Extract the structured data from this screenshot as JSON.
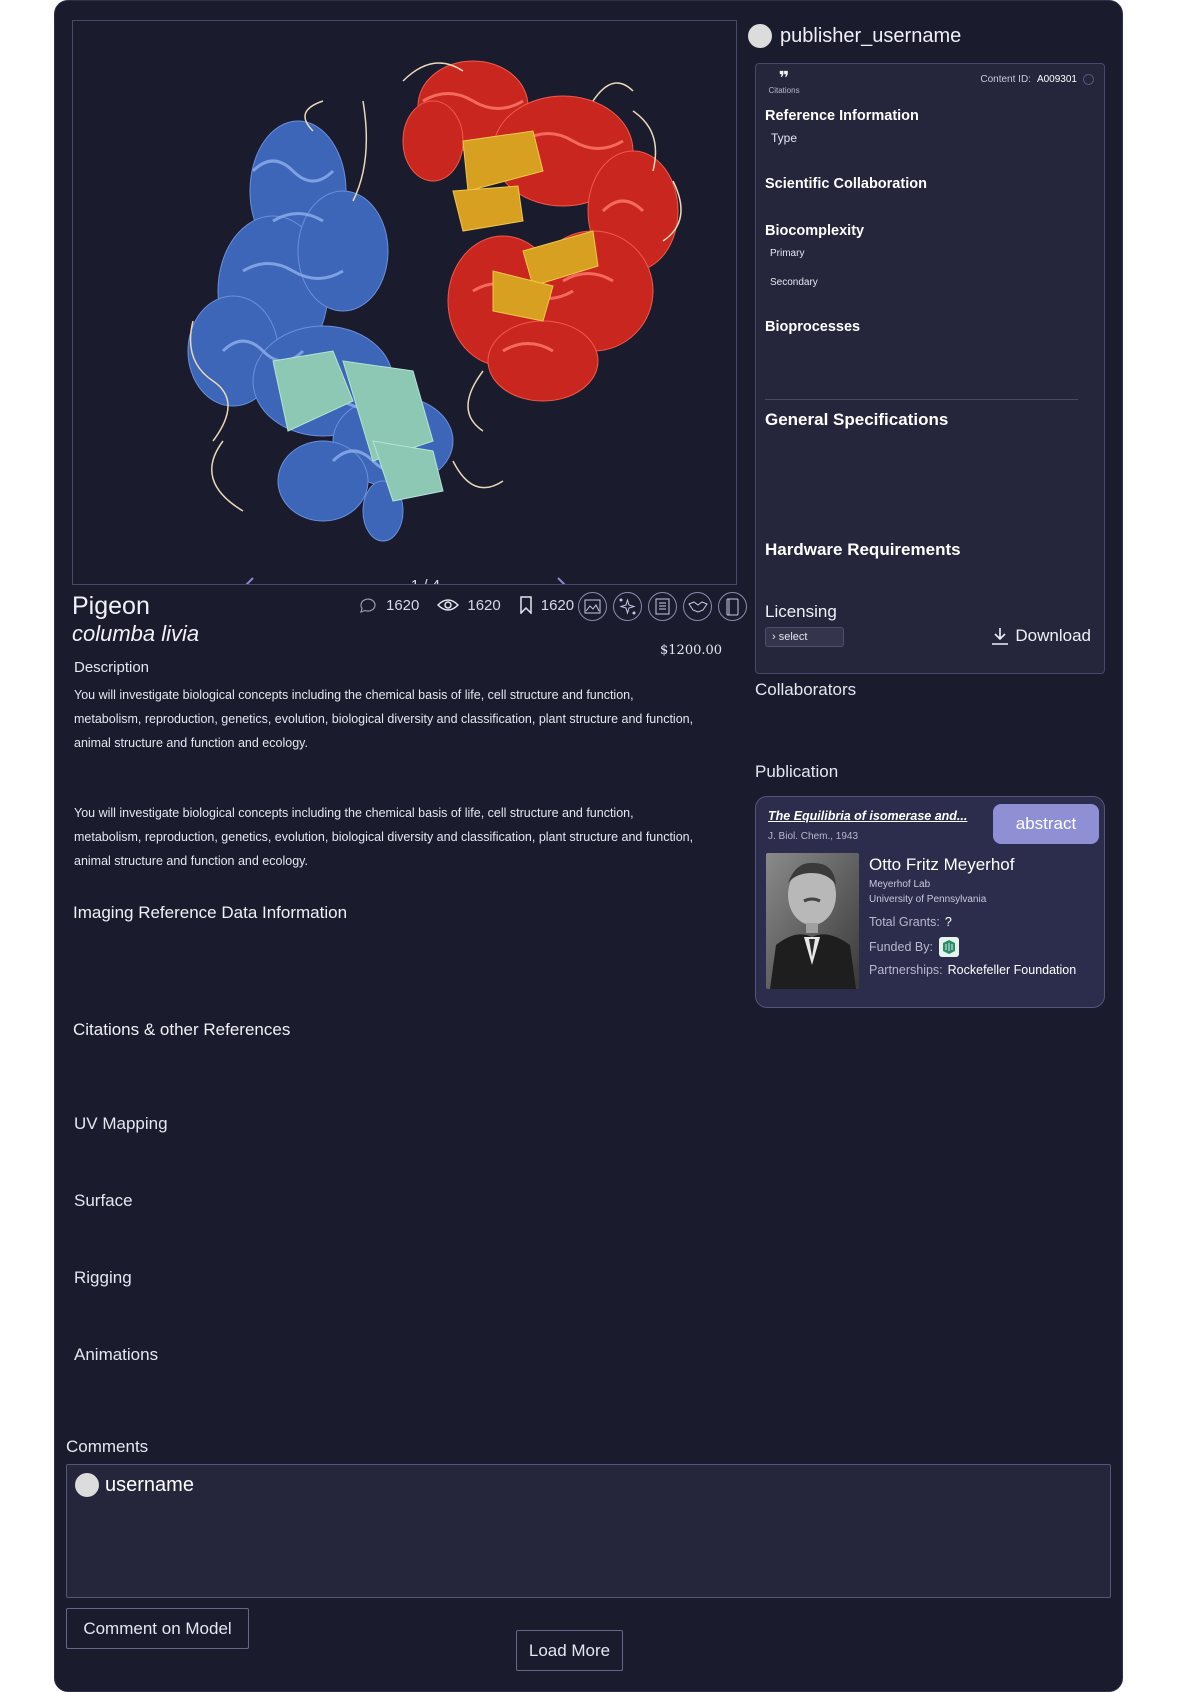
{
  "viewer": {
    "counter": "1 / 4"
  },
  "model": {
    "name": "Pigeon",
    "species": "columba livia",
    "price": "$1200.00",
    "stats": {
      "comments": "1620",
      "views": "1620",
      "bookmarks": "1620"
    },
    "tool_icons": [
      "image-icon",
      "sparkle-network-icon",
      "document-icon",
      "handshake-icon",
      "book-icon"
    ]
  },
  "description": {
    "title": "Description",
    "paragraph_1": "You will investigate biological concepts including the chemical basis of life, cell structure and function, metabolism, reproduction, genetics, evolution, biological diversity and classification, plant structure and function, animal structure and function and ecology.",
    "paragraph_2": "You will investigate biological concepts including the chemical basis of life, cell structure and function, metabolism, reproduction, genetics, evolution, biological diversity and classification, plant structure and function, animal structure and function and ecology."
  },
  "sections": {
    "imaging": "Imaging Reference Data Information",
    "citations": "Citations & other References",
    "uv_mapping": "UV Mapping",
    "surface": "Surface",
    "rigging": "Rigging",
    "animations": "Animations"
  },
  "publisher": {
    "username": "publisher_username"
  },
  "info_panel": {
    "citations_label": "Citations",
    "content_id_label": "Content ID:",
    "content_id": "A009301",
    "reference_information": "Reference Information",
    "type_label": "Type",
    "scientific_collaboration": "Scientific Collaboration",
    "biocomplexity": "Biocomplexity",
    "primary": "Primary",
    "secondary": "Secondary",
    "bioprocesses": "Bioprocesses",
    "general_specifications": "General Specifications",
    "hardware_requirements": "Hardware Requirements",
    "licensing": "Licensing",
    "select": "select",
    "download": "Download"
  },
  "collaborators_label": "Collaborators",
  "publication": {
    "label": "Publication",
    "paper_title": "The Equilibria of isomerase and...",
    "journal": "J. Biol. Chem., 1943",
    "abstract_button": "abstract",
    "person_name": "Otto Fritz Meyerhof",
    "lab": "Meyerhof Lab",
    "university": "University of Pennsylvania",
    "total_grants_label": "Total Grants:",
    "total_grants": "?",
    "funded_by_label": "Funded By:",
    "partnerships_label": "Partnerships:",
    "partnerships": "Rockefeller Foundation"
  },
  "comments": {
    "label": "Comments",
    "username": "username",
    "comment_button": "Comment on Model",
    "load_more": "Load More"
  },
  "colors": {
    "background": "#1b1b2e",
    "panel": "#25253c",
    "accent": "#8f8fd6",
    "protein_blue": "#4a74c8",
    "protein_red": "#d8302a",
    "protein_gold": "#d8a020",
    "protein_teal": "#8cc8b4"
  }
}
